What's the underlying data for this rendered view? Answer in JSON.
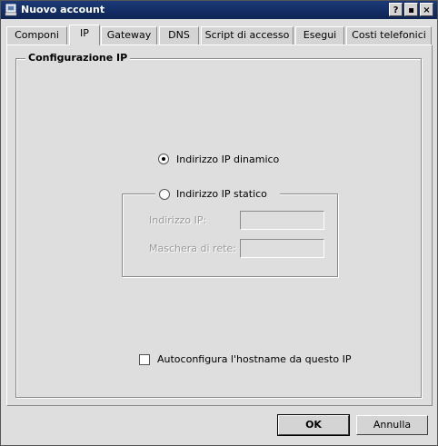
{
  "window": {
    "title": "Nuovo account",
    "buttons": {
      "help": "?",
      "maximize": "▪",
      "close": "×"
    }
  },
  "tabs": [
    "Componi",
    "IP",
    "Gateway",
    "DNS",
    "Script di accesso",
    "Esegui",
    "Costi telefonici"
  ],
  "active_tab": "IP",
  "config_group": {
    "title": "Configurazione IP",
    "dynamic_label": "Indirizzo IP dinamico",
    "dynamic_selected": true,
    "static_label": "Indirizzo IP statico",
    "static_selected": false,
    "ip_label": "Indirizzo IP:",
    "ip_value": "",
    "mask_label": "Maschera di rete:",
    "mask_value": "",
    "autoconfig_label": "Autoconfigura l'hostname da questo IP",
    "autoconfig_checked": false
  },
  "footer": {
    "ok": "OK",
    "cancel": "Annulla"
  },
  "icons": {
    "app": "network-account-icon"
  }
}
